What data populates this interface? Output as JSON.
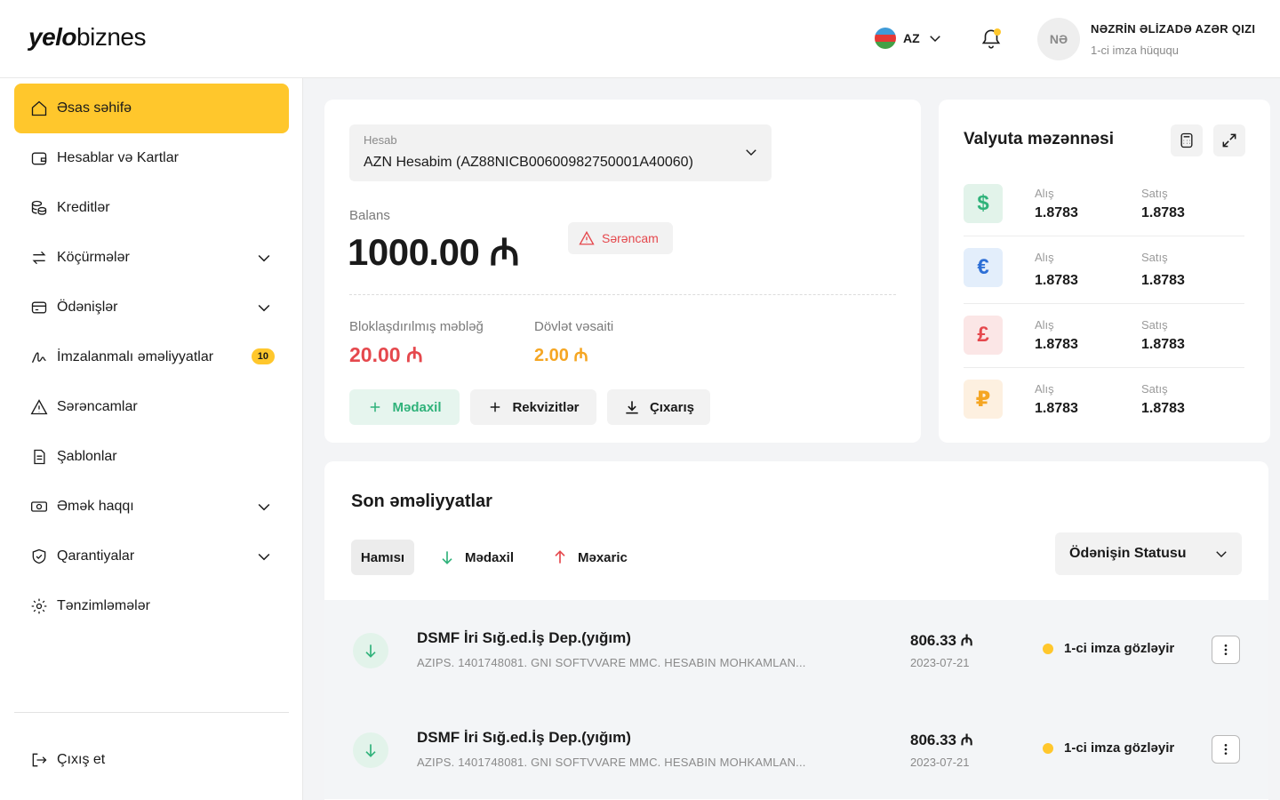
{
  "header": {
    "logo_bold": "yelo",
    "logo_light": "biznes",
    "language": "AZ",
    "user_initials": "NƏ",
    "user_name": "NƏZRİN ƏLİZADƏ AZƏR QIZI",
    "user_role": "1-ci imza hüququ"
  },
  "sidebar": {
    "items": [
      {
        "label": "Əsas səhifə",
        "icon": "home-icon"
      },
      {
        "label": "Hesablar və Kartlar",
        "icon": "wallet-icon"
      },
      {
        "label": "Kreditlər",
        "icon": "coins-icon"
      },
      {
        "label": "Köçürmələr",
        "icon": "transfer-icon"
      },
      {
        "label": "Ödənişlər",
        "icon": "card-icon"
      },
      {
        "label": "İmzalanmalı əməliyyatlar",
        "icon": "signature-icon",
        "badge": "10"
      },
      {
        "label": "Sərəncamlar",
        "icon": "warning-icon"
      },
      {
        "label": "Şablonlar",
        "icon": "document-icon"
      },
      {
        "label": "Əmək haqqı",
        "icon": "cash-icon"
      },
      {
        "label": "Qarantiyalar",
        "icon": "shield-icon"
      },
      {
        "label": "Tənzimləmələr",
        "icon": "settings-icon"
      }
    ],
    "logout": "Çıxış et"
  },
  "account": {
    "select_label": "Hesab",
    "select_value": "AZN Hesabim (AZ88NICB00600982750001A40060)",
    "balance_label": "Balans",
    "balance_value": "1000.00 ₼",
    "order_chip": "Sərəncam",
    "blocked_label": "Bloklaşdırılmış məbləğ",
    "blocked_value": "20.00 ₼",
    "state_label": "Dövlət vəsaiti",
    "state_value": "2.00 ₼",
    "btn_income": "Mədaxil",
    "btn_requisites": "Rekvizitlər",
    "btn_statement": "Çıxarış"
  },
  "currency": {
    "title": "Valyuta məzənnəsi",
    "rows": [
      {
        "symbol": "$",
        "buy_label": "Alış",
        "buy": "1.8783",
        "sell_label": "Satış",
        "sell": "1.8783"
      },
      {
        "symbol": "€",
        "buy_label": "Alış",
        "buy": "1.8783",
        "sell_label": "Satış",
        "sell": "1.8783"
      },
      {
        "symbol": "£",
        "buy_label": "Alış",
        "buy": "1.8783",
        "sell_label": "Satış",
        "sell": "1.8783"
      },
      {
        "symbol": "₽",
        "buy_label": "Alış",
        "buy": "1.8783",
        "sell_label": "Satış",
        "sell": "1.8783"
      }
    ]
  },
  "transactions": {
    "title": "Son əməliyyatlar",
    "filter_all": "Hamısı",
    "filter_income": "Mədaxil",
    "filter_outgoing": "Məxaric",
    "status_dropdown": "Ödənişin Statusu",
    "rows": [
      {
        "name": "DSMF İri Sığ.ed.İş Dep.(yığım)",
        "desc": "AZIPS. 1401748081. GNI SOFTVVARE MMC. HESABIN MOHKAMLAN...",
        "amount": "806.33 ₼",
        "date": "2023-07-21",
        "status": "1-ci imza gözləyir"
      },
      {
        "name": "DSMF İri Sığ.ed.İş Dep.(yığım)",
        "desc": "AZIPS. 1401748081. GNI SOFTVVARE MMC. HESABIN MOHKAMLAN...",
        "amount": "806.33 ₼",
        "date": "2023-07-21",
        "status": "1-ci imza gözləyir"
      }
    ]
  },
  "colors": {
    "accent": "#ffc72c",
    "danger": "#e5484d",
    "warning": "#f5a623",
    "success": "#2fb27a"
  }
}
